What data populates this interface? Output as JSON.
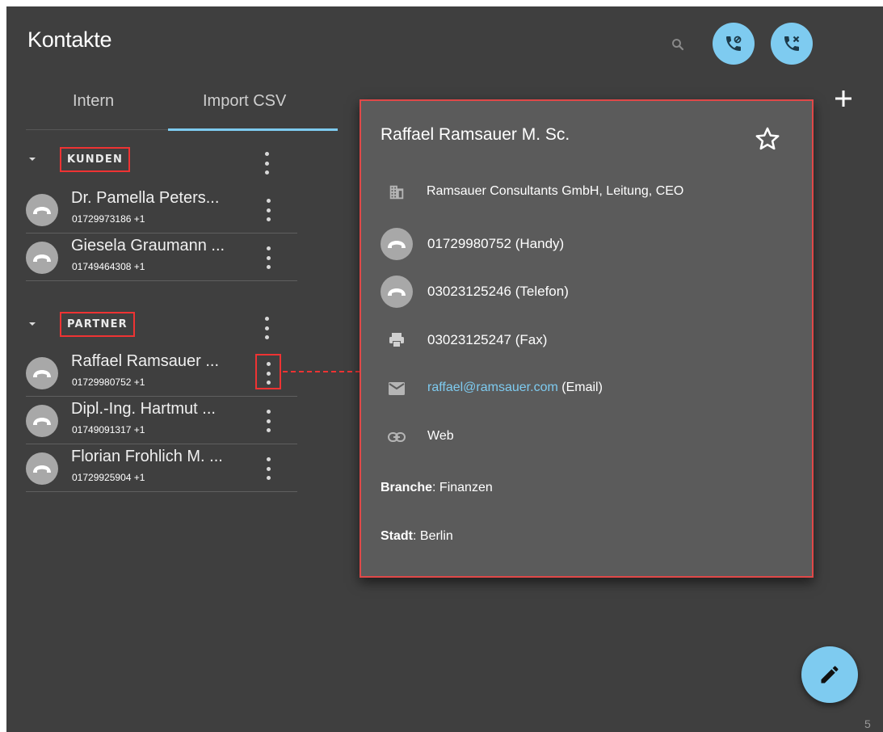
{
  "header": {
    "title": "Kontakte",
    "icons": [
      "search-icon",
      "phone-forward-icon",
      "phone-missed-icon",
      "plus-icon"
    ]
  },
  "tabs": [
    {
      "label": "Intern",
      "active": false
    },
    {
      "label": "Import CSV",
      "active": true
    }
  ],
  "groups": [
    {
      "label": "KUNDEN",
      "contacts": [
        {
          "name": "Dr. Pamella Peters...",
          "phone": "01729973186 +1"
        },
        {
          "name": "Giesela Graumann ...",
          "phone": "01749464308 +1"
        }
      ]
    },
    {
      "label": "PARTNER",
      "contacts": [
        {
          "name": "Raffael Ramsauer ...",
          "phone": "01729980752 +1"
        },
        {
          "name": "Dipl.-Ing. Hartmut ...",
          "phone": "01749091317 +1"
        },
        {
          "name": "Florian Frohlich M. ...",
          "phone": "01729925904 +1"
        }
      ]
    }
  ],
  "detail": {
    "name": "Raffael Ramsauer M. Sc.",
    "company": "Ramsauer Consultants GmbH, Leitung, CEO",
    "mobile": "01729980752 (Handy)",
    "phone": "03023125246 (Telefon)",
    "fax": "03023125247 (Fax)",
    "email_address": "raffael@ramsauer.com",
    "email_suffix": " (Email)",
    "web": "Web",
    "branche_label": "Branche",
    "branche_value": ": Finanzen",
    "stadt_label": "Stadt",
    "stadt_value": ": Berlin"
  },
  "footer": {
    "page": "5"
  },
  "colors": {
    "accent": "#7ecbf0",
    "highlight": "#e33333",
    "background": "#3f3f3f",
    "card": "#5b5b5b"
  }
}
